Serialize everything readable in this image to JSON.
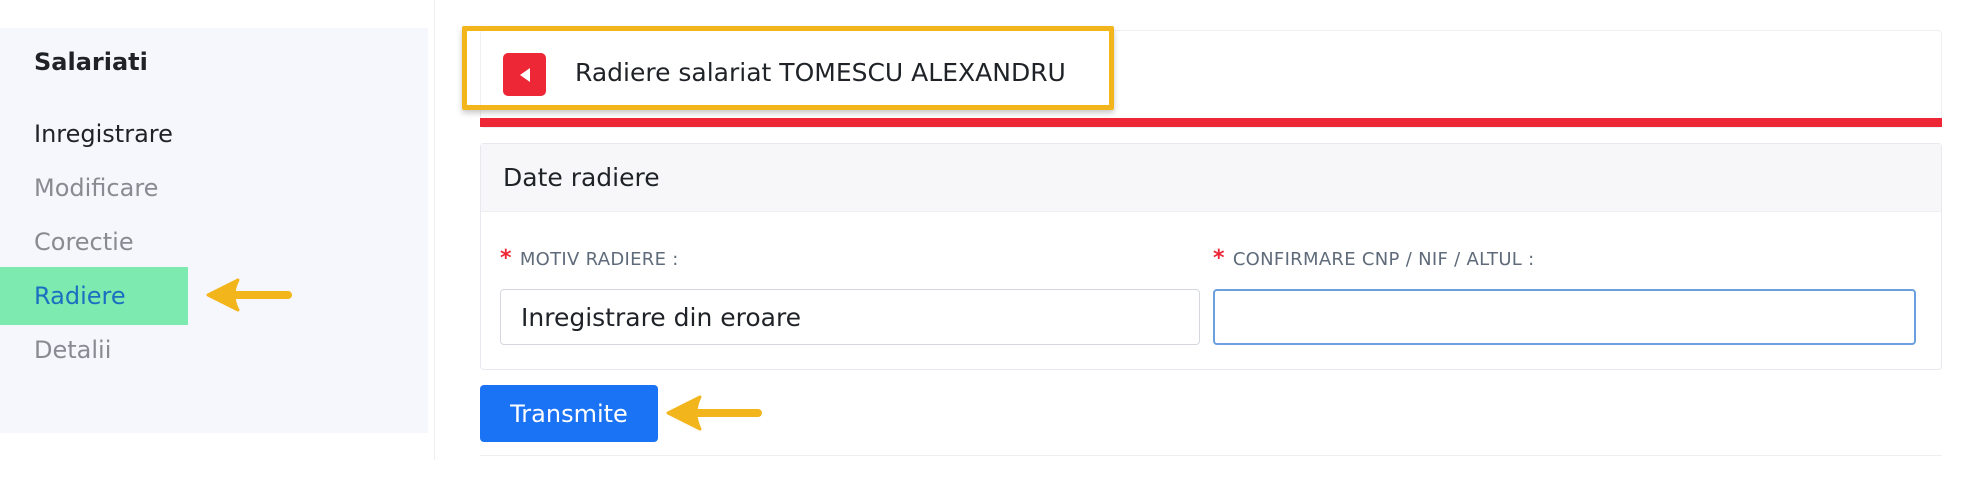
{
  "sidebar": {
    "heading": "Salariati",
    "items": [
      {
        "label": "Inregistrare",
        "state": "default-dark"
      },
      {
        "label": "Modificare",
        "state": "default"
      },
      {
        "label": "Corectie",
        "state": "default"
      },
      {
        "label": "Radiere",
        "state": "active"
      },
      {
        "label": "Detalii",
        "state": "default"
      }
    ]
  },
  "header": {
    "back_icon": "caret-left-icon",
    "title": "Radiere salariat TOMESCU ALEXANDRU"
  },
  "section": {
    "title": "Date radiere",
    "fields": [
      {
        "required_mark": "*",
        "label": "MOTIV RADIERE :",
        "value": "Inregistrare din eroare"
      },
      {
        "required_mark": "*",
        "label": "CONFIRMARE CNP / NIF / ALTUL :",
        "value": ""
      }
    ]
  },
  "actions": {
    "submit_label": "Transmite"
  },
  "colors": {
    "accent_red": "#ee2737",
    "active_bg": "#7debb0",
    "active_text": "#1b6fc0",
    "primary_blue": "#1a73f5",
    "annotation_yellow": "#f2b61c"
  },
  "annotations": [
    "arrow-left-icon",
    "arrow-left-icon",
    "highlight-box"
  ]
}
